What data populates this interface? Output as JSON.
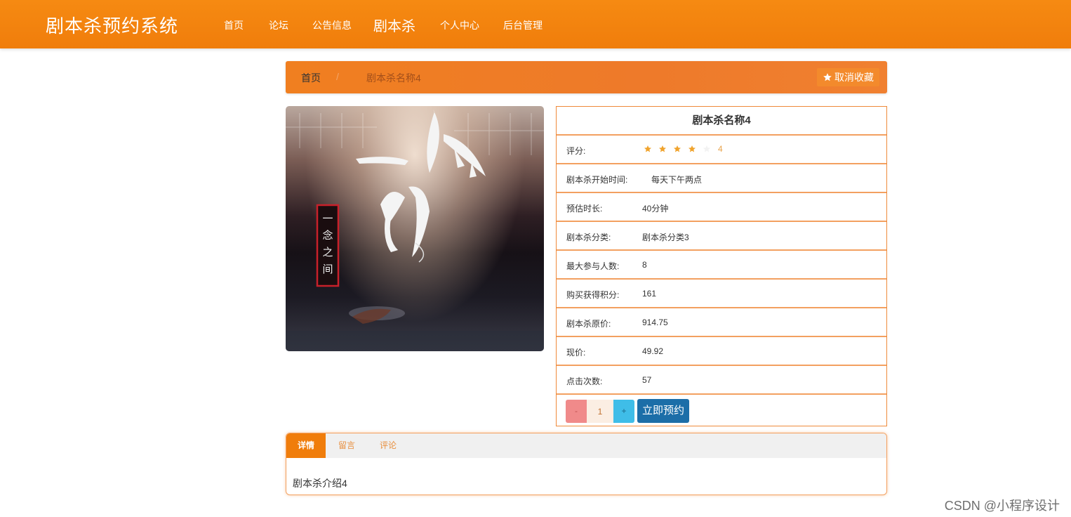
{
  "app": {
    "title": "剧本杀预约系统"
  },
  "nav": {
    "items": [
      {
        "label": "首页"
      },
      {
        "label": "论坛"
      },
      {
        "label": "公告信息"
      },
      {
        "label": "剧本杀"
      },
      {
        "label": "个人中心"
      },
      {
        "label": "后台管理"
      }
    ],
    "active": "剧本杀"
  },
  "breadcrumb": {
    "home": "首页",
    "separator": "/",
    "current": "剧本杀名称4"
  },
  "favorite_button": {
    "label": "取消收藏",
    "icon": "star-icon"
  },
  "cover": {
    "title_art": "一念",
    "subtitle_art": "一念之间",
    "icon": "book-cover-image"
  },
  "detail": {
    "name": "剧本杀名称4",
    "rating": {
      "label": "评分:",
      "value": 4,
      "max": 5,
      "score_text": "4"
    },
    "rows": [
      {
        "label": "剧本杀开始时间:",
        "value": "每天下午两点"
      },
      {
        "label": "预估时长:",
        "value": "40分钟"
      },
      {
        "label": "剧本杀分类:",
        "value": "剧本杀分类3"
      },
      {
        "label": "最大参与人数:",
        "value": "8"
      },
      {
        "label": "购买获得积分:",
        "value": "161"
      },
      {
        "label": "剧本杀原价:",
        "value": "914.75"
      },
      {
        "label": "现价:",
        "value": "49.92"
      },
      {
        "label": "点击次数:",
        "value": "57"
      }
    ]
  },
  "quantity": {
    "minus": "-",
    "value": "1",
    "plus": "+"
  },
  "book_button": {
    "label": "立即预约"
  },
  "tabs": {
    "items": [
      {
        "label": "详情"
      },
      {
        "label": "留言"
      },
      {
        "label": "评论"
      }
    ],
    "active": "详情",
    "content": "剧本杀介绍4"
  },
  "watermark": "CSDN @小程序设计",
  "colors": {
    "primary": "#f07d0b",
    "breadcrumb": "#ef7b26",
    "book_button": "#1c6ea8",
    "star": "#f0a32c",
    "minus": "#f08a8a",
    "plus": "#3fbde8"
  }
}
